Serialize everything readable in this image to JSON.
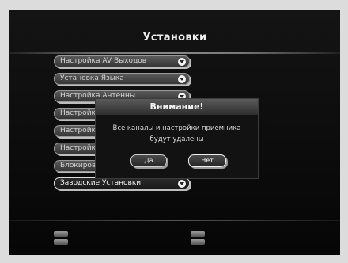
{
  "screen": {
    "title": "Установки"
  },
  "menu": {
    "items": [
      {
        "label": "Настройка AV Выходов"
      },
      {
        "label": "Установка Языка"
      },
      {
        "label": "Настройка Антенны"
      },
      {
        "label": "Настройка"
      },
      {
        "label": "Настройка"
      },
      {
        "label": "Настройка"
      },
      {
        "label": "Блокировка"
      },
      {
        "label": "Заводские Установки"
      }
    ],
    "selected_index": 7
  },
  "dialog": {
    "title": "Внимание!",
    "message_line1": "Все каналы и настройки приемника",
    "message_line2": "будут удалены",
    "yes_label": "Да",
    "no_label": "Нет",
    "focused_button": "no"
  }
}
